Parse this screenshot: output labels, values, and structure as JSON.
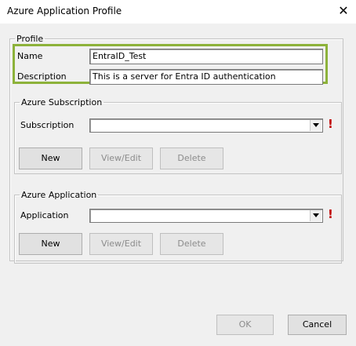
{
  "window": {
    "title": "Azure Application Profile"
  },
  "profile": {
    "group_label": "Profile",
    "name_label": "Name",
    "name_value": "EntraID_Test",
    "description_label": "Description",
    "description_value": "This is a server for Entra ID authentication"
  },
  "subscription": {
    "group_label": "Azure Subscription",
    "field_label": "Subscription",
    "selected_value": "",
    "warning_glyph": "!",
    "buttons": {
      "new": "New",
      "view_edit": "View/Edit",
      "delete": "Delete"
    }
  },
  "application": {
    "group_label": "Azure Application",
    "field_label": "Application",
    "selected_value": "",
    "warning_glyph": "!",
    "buttons": {
      "new": "New",
      "view_edit": "View/Edit",
      "delete": "Delete"
    }
  },
  "footer": {
    "ok": "OK",
    "cancel": "Cancel"
  },
  "colors": {
    "highlight": "#8db23a",
    "warning": "#c00000"
  },
  "icons": {
    "close": "close-icon",
    "dropdown": "chevron-down-icon"
  }
}
